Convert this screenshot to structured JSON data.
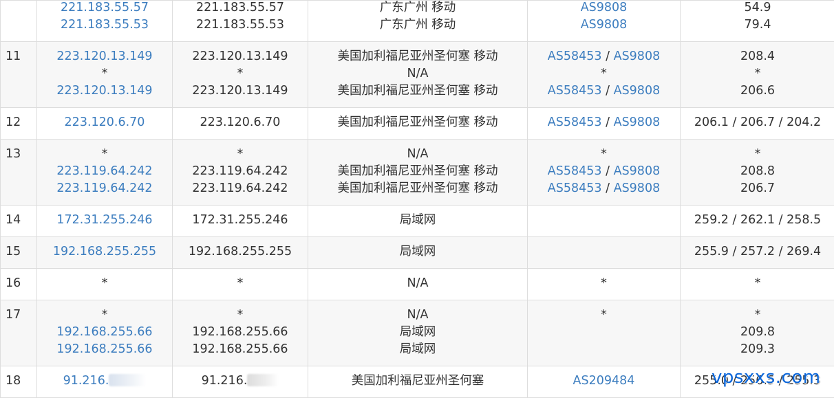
{
  "rows": [
    {
      "hop": "",
      "ip_link": [
        "221.183.55.57",
        "221.183.55.53"
      ],
      "ip": [
        "221.183.55.57",
        "221.183.55.53"
      ],
      "loc": [
        "广东广州 移动",
        "广东广州 移动"
      ],
      "as": [
        [
          "AS9808"
        ],
        [
          "AS9808"
        ]
      ],
      "rtt": [
        "54.9",
        "79.4"
      ]
    },
    {
      "hop": "11",
      "ip_link": [
        "223.120.13.149",
        "*",
        "223.120.13.149"
      ],
      "ip": [
        "223.120.13.149",
        "*",
        "223.120.13.149"
      ],
      "loc": [
        "美国加利福尼亚州圣何塞 移动",
        "N/A",
        "美国加利福尼亚州圣何塞 移动"
      ],
      "as": [
        [
          "AS58453",
          "AS9808"
        ],
        [
          "*"
        ],
        [
          "AS58453",
          "AS9808"
        ]
      ],
      "rtt": [
        "208.4",
        "*",
        "206.6"
      ]
    },
    {
      "hop": "12",
      "ip_link": [
        "223.120.6.70"
      ],
      "ip": [
        "223.120.6.70"
      ],
      "loc": [
        "美国加利福尼亚州圣何塞 移动"
      ],
      "as": [
        [
          "AS58453",
          "AS9808"
        ]
      ],
      "rtt": [
        "206.1 / 206.7 / 204.2"
      ]
    },
    {
      "hop": "13",
      "ip_link": [
        "*",
        "223.119.64.242",
        "223.119.64.242"
      ],
      "ip": [
        "*",
        "223.119.64.242",
        "223.119.64.242"
      ],
      "loc": [
        "N/A",
        "美国加利福尼亚州圣何塞 移动",
        "美国加利福尼亚州圣何塞 移动"
      ],
      "as": [
        [
          "*"
        ],
        [
          "AS58453",
          "AS9808"
        ],
        [
          "AS58453",
          "AS9808"
        ]
      ],
      "rtt": [
        "*",
        "208.8",
        "206.7"
      ]
    },
    {
      "hop": "14",
      "ip_link": [
        "172.31.255.246"
      ],
      "ip": [
        "172.31.255.246"
      ],
      "loc": [
        "局域网"
      ],
      "as": [],
      "rtt": [
        "259.2 / 262.1 / 258.5"
      ]
    },
    {
      "hop": "15",
      "ip_link": [
        "192.168.255.255"
      ],
      "ip": [
        "192.168.255.255"
      ],
      "loc": [
        "局域网"
      ],
      "as": [],
      "rtt": [
        "255.9 / 257.2 / 269.4"
      ]
    },
    {
      "hop": "16",
      "ip_link": [
        "*"
      ],
      "ip": [
        "*"
      ],
      "loc": [
        "N/A"
      ],
      "as": [
        [
          "*"
        ]
      ],
      "rtt": [
        "*"
      ]
    },
    {
      "hop": "17",
      "ip_link": [
        "*",
        "192.168.255.66",
        "192.168.255.66"
      ],
      "ip": [
        "*",
        "192.168.255.66",
        "192.168.255.66"
      ],
      "loc": [
        "N/A",
        "局域网",
        "局域网"
      ],
      "as": [
        [
          "*"
        ]
      ],
      "rtt": [
        "*",
        "209.8",
        "209.3"
      ]
    },
    {
      "hop": "18",
      "ip_link": [
        "91.216."
      ],
      "ip": [
        "91.216."
      ],
      "loc": [
        "美国加利福尼亚州圣何塞"
      ],
      "as": [
        [
          "AS209484"
        ]
      ],
      "rtt": [
        "255.0 / 256.5 / 255.3"
      ]
    }
  ],
  "watermark": "vpsxxs.com",
  "colors": {
    "link": "#3c7dbf",
    "text": "#333333",
    "border": "#dddddd",
    "zebra": "#f7f7f7",
    "watermark": "#0b66d9"
  }
}
